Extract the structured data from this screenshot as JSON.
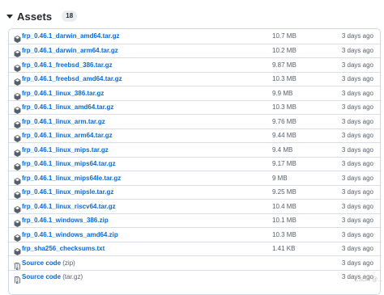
{
  "assets": {
    "title": "Assets",
    "count": "18"
  },
  "rows": [
    {
      "name": "frp_0.46.1_darwin_amd64.tar.gz",
      "suffix": "",
      "size": "10.7 MB",
      "date": "3 days ago",
      "icon": "package-icon"
    },
    {
      "name": "frp_0.46.1_darwin_arm64.tar.gz",
      "suffix": "",
      "size": "10.2 MB",
      "date": "3 days ago",
      "icon": "package-icon"
    },
    {
      "name": "frp_0.46.1_freebsd_386.tar.gz",
      "suffix": "",
      "size": "9.87 MB",
      "date": "3 days ago",
      "icon": "package-icon"
    },
    {
      "name": "frp_0.46.1_freebsd_amd64.tar.gz",
      "suffix": "",
      "size": "10.3 MB",
      "date": "3 days ago",
      "icon": "package-icon"
    },
    {
      "name": "frp_0.46.1_linux_386.tar.gz",
      "suffix": "",
      "size": "9.9 MB",
      "date": "3 days ago",
      "icon": "package-icon"
    },
    {
      "name": "frp_0.46.1_linux_amd64.tar.gz",
      "suffix": "",
      "size": "10.3 MB",
      "date": "3 days ago",
      "icon": "package-icon"
    },
    {
      "name": "frp_0.46.1_linux_arm.tar.gz",
      "suffix": "",
      "size": "9.76 MB",
      "date": "3 days ago",
      "icon": "package-icon"
    },
    {
      "name": "frp_0.46.1_linux_arm64.tar.gz",
      "suffix": "",
      "size": "9.44 MB",
      "date": "3 days ago",
      "icon": "package-icon"
    },
    {
      "name": "frp_0.46.1_linux_mips.tar.gz",
      "suffix": "",
      "size": "9.4 MB",
      "date": "3 days ago",
      "icon": "package-icon"
    },
    {
      "name": "frp_0.46.1_linux_mips64.tar.gz",
      "suffix": "",
      "size": "9.17 MB",
      "date": "3 days ago",
      "icon": "package-icon"
    },
    {
      "name": "frp_0.46.1_linux_mips64le.tar.gz",
      "suffix": "",
      "size": "9 MB",
      "date": "3 days ago",
      "icon": "package-icon"
    },
    {
      "name": "frp_0.46.1_linux_mipsle.tar.gz",
      "suffix": "",
      "size": "9.25 MB",
      "date": "3 days ago",
      "icon": "package-icon"
    },
    {
      "name": "frp_0.46.1_linux_riscv64.tar.gz",
      "suffix": "",
      "size": "10.4 MB",
      "date": "3 days ago",
      "icon": "package-icon"
    },
    {
      "name": "frp_0.46.1_windows_386.zip",
      "suffix": "",
      "size": "10.1 MB",
      "date": "3 days ago",
      "icon": "package-icon"
    },
    {
      "name": "frp_0.46.1_windows_amd64.zip",
      "suffix": "",
      "size": "10.3 MB",
      "date": "3 days ago",
      "icon": "package-icon"
    },
    {
      "name": "frp_sha256_checksums.txt",
      "suffix": "",
      "size": "1.41 KB",
      "date": "3 days ago",
      "icon": "package-icon"
    },
    {
      "name": "Source code ",
      "suffix": "(zip)",
      "size": "",
      "date": "3 days ago",
      "icon": "file-zip-icon"
    },
    {
      "name": "Source code ",
      "suffix": "(tar.gz)",
      "size": "",
      "date": "3 days ago",
      "icon": "file-zip-icon"
    }
  ],
  "watermark": "CSDN @...",
  "colors": {
    "link": "#0969da",
    "muted": "#57606a",
    "border": "#d0d7de"
  }
}
